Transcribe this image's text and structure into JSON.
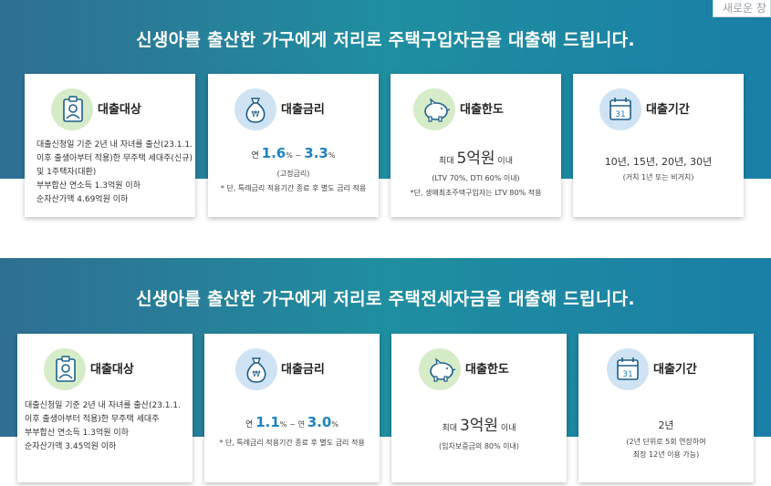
{
  "top_button": "새로운 창",
  "section1": {
    "title": "신생아를 출산한 가구에게 저리로 주택구입자금을 대출해 드립니다.",
    "cards": {
      "target": {
        "label": "대출대상",
        "lines": [
          "대출신청일 기준 2년 내 자녀를 출산(23.1.1.",
          "이후 출생아부터 적용)한 무주택 세대주(신규)",
          "및 1주택자(대환)",
          "부부합산 연소득 1.3억원 이하",
          "순자산가액 4.69억원 이하"
        ]
      },
      "rate": {
        "label": "대출금리",
        "prefix": "연",
        "from": "1.6",
        "from_unit": "%",
        "sep": "~",
        "to": "3.3",
        "to_unit": "%",
        "note1": "(고정금리)",
        "note2": "* 단, 특례금리 적용기간 종료 후 별도 금리 적용"
      },
      "limit": {
        "label": "대출한도",
        "prefix": "최대",
        "amount": "5억원",
        "suffix": "이내",
        "note1": "(LTV 70%, DTI 60% 이내)",
        "note2": "*단, 생애최초주택구입자는 LTV 80% 적용"
      },
      "period": {
        "label": "대출기간",
        "calendar_day": "31",
        "main": "10년, 15년, 20년, 30년",
        "note1": "(거치 1년 또는 비거치)"
      }
    }
  },
  "section2": {
    "title": "신생아를 출산한 가구에게 저리로 주택전세자금을 대출해 드립니다.",
    "cards": {
      "target": {
        "label": "대출대상",
        "lines": [
          "대출신청일 기준 2년 내 자녀를 출산(23.1.1.",
          "이후 출생아부터 적용)한 무주택 세대주",
          "부부합산 연소득 1.3억원 이하",
          "순자산가액 3.45억원 이하"
        ]
      },
      "rate": {
        "label": "대출금리",
        "prefix": "연",
        "from": "1.1",
        "from_unit": "%",
        "sep": "~ 연",
        "to": "3.0",
        "to_unit": "%",
        "note2": "* 단, 특례금리 적용기간 종료 후 별도 금리 적용"
      },
      "limit": {
        "label": "대출한도",
        "prefix": "최대",
        "amount": "3억원",
        "suffix": "이내",
        "note1": "(임차보증금의 80% 이내)"
      },
      "period": {
        "label": "대출기간",
        "calendar_day": "31",
        "main": "2년",
        "note1": "(2년 단위로 5회 연장하여",
        "note2": "최장 12년 이용 가능)"
      }
    }
  },
  "colors": {
    "band_start": "#2f6f93",
    "band_end": "#1a7fa6",
    "accent": "#1e82c4",
    "icon_bg_blue": "#cfe3f5",
    "icon_bg_green": "#d6ecc9"
  }
}
